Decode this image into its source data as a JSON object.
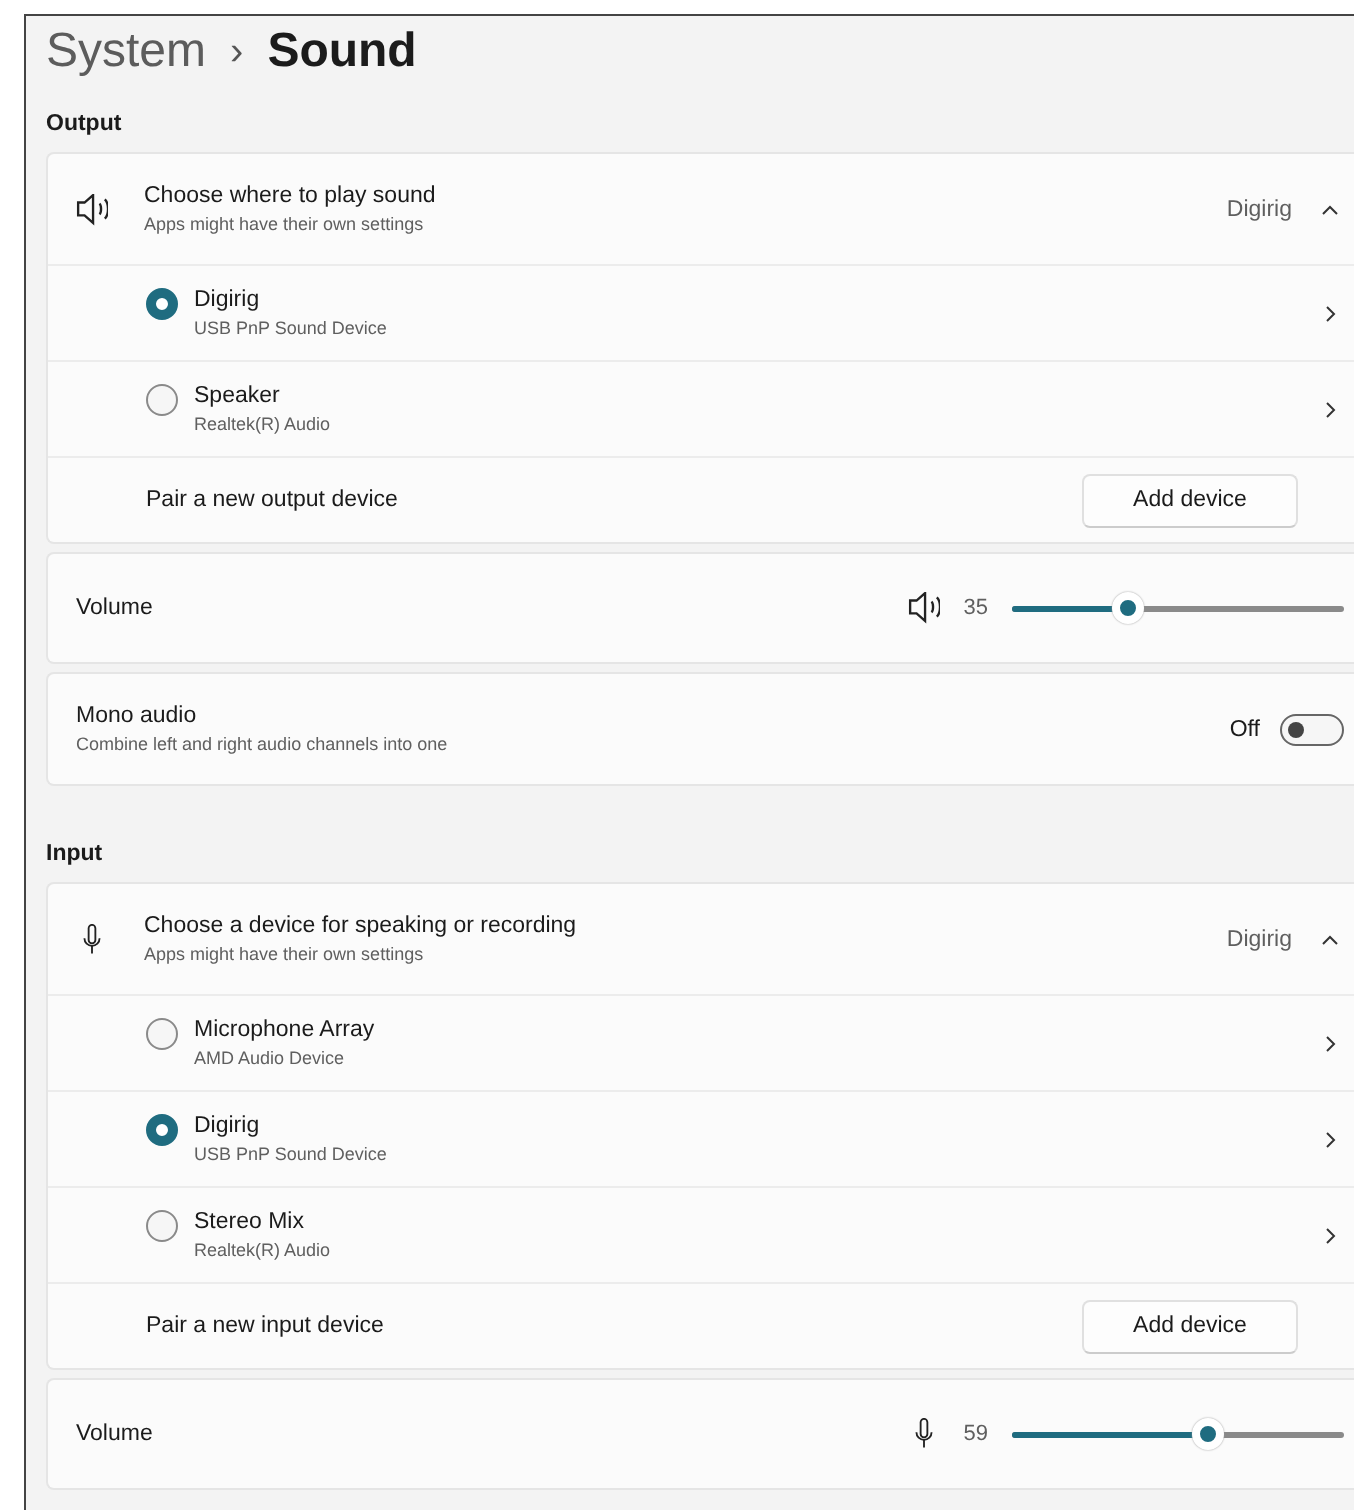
{
  "breadcrumb": {
    "parent": "System",
    "separator": "›",
    "current": "Sound"
  },
  "sections": [
    {
      "heading": "Output",
      "cards": [
        {
          "kind": "expander",
          "title": "Choose where to play sound",
          "subtitle": "Apps might have their own settings",
          "value": "Digirig",
          "expanded": true,
          "devices": [
            {
              "name": "Digirig",
              "detail": "USB PnP Sound Device",
              "selected": true
            },
            {
              "name": "Speaker",
              "detail": "Realtek(R) Audio",
              "selected": false
            }
          ],
          "pair": {
            "label": "Pair a new output device",
            "button": "Add device"
          }
        },
        {
          "kind": "slider",
          "label": "Volume",
          "reading": "35",
          "level": 0.35
        },
        {
          "kind": "toggle",
          "label": "Mono audio",
          "subtitle": "Combine left and right audio channels into one",
          "state_text": "Off",
          "on": false
        }
      ]
    },
    {
      "heading": "Input",
      "cards": [
        {
          "kind": "expander",
          "title": "Choose a device for speaking or recording",
          "subtitle": "Apps might have their own settings",
          "value": "Digirig",
          "expanded": true,
          "devices": [
            {
              "name": "Microphone Array",
              "detail": "AMD Audio Device",
              "selected": false
            },
            {
              "name": "Digirig",
              "detail": "USB PnP Sound Device",
              "selected": true
            },
            {
              "name": "Stereo Mix",
              "detail": "Realtek(R) Audio",
              "selected": false
            }
          ],
          "pair": {
            "label": "Pair a new input device",
            "button": "Add device"
          }
        },
        {
          "kind": "slider",
          "label": "Volume",
          "reading": "59",
          "level": 0.59
        }
      ]
    }
  ]
}
